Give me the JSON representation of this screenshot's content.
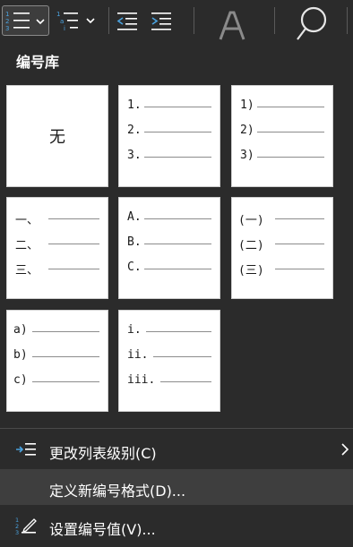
{
  "ribbon": {
    "buttons": [
      {
        "name": "numbered-list-icon"
      },
      {
        "name": "multilevel-list-icon"
      },
      {
        "name": "decrease-indent-icon"
      },
      {
        "name": "increase-indent-icon"
      },
      {
        "name": "font-style-icon"
      },
      {
        "name": "search-icon"
      }
    ]
  },
  "library": {
    "title": "编号库",
    "tiles": [
      {
        "id": "none",
        "label": "无"
      },
      {
        "id": "arabic-dot",
        "markers": [
          "1.",
          "2.",
          "3."
        ]
      },
      {
        "id": "arabic-paren",
        "markers": [
          "1)",
          "2)",
          "3)"
        ]
      },
      {
        "id": "chinese-comma",
        "markers": [
          "一、",
          "二、",
          "三、"
        ]
      },
      {
        "id": "upper-alpha-dot",
        "markers": [
          "A.",
          "B.",
          "C."
        ]
      },
      {
        "id": "chinese-paren",
        "markers": [
          "(一)",
          "(二)",
          "(三)"
        ]
      },
      {
        "id": "lower-alpha-paren",
        "markers": [
          "a)",
          "b)",
          "c)"
        ]
      },
      {
        "id": "lower-roman-dot",
        "markers": [
          "i.",
          "ii.",
          "iii."
        ]
      }
    ]
  },
  "menu": {
    "change_level": "更改列表级别(C)",
    "define_format": "定义新编号格式(D)...",
    "set_value": "设置编号值(V)..."
  },
  "colors": {
    "background": "#2b2b2b",
    "accent": "#4aa3e0",
    "highlight": "#3e3e3e"
  }
}
